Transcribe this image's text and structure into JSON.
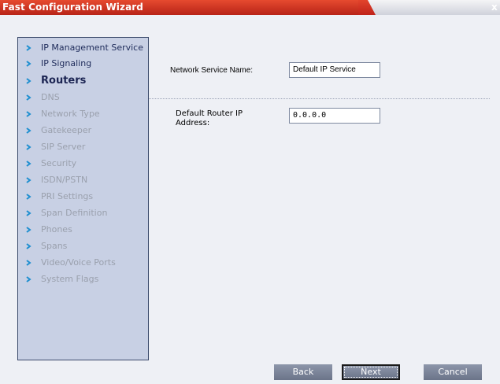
{
  "window": {
    "title": "Fast Configuration Wizard",
    "close_glyph": "x"
  },
  "sidebar": {
    "items": [
      {
        "label": "IP Management Service",
        "state": "visited"
      },
      {
        "label": "IP Signaling",
        "state": "visited"
      },
      {
        "label": "Routers",
        "state": "active"
      },
      {
        "label": "DNS",
        "state": "disabled"
      },
      {
        "label": "Network Type",
        "state": "disabled"
      },
      {
        "label": "Gatekeeper",
        "state": "disabled"
      },
      {
        "label": "SIP Server",
        "state": "disabled"
      },
      {
        "label": "Security",
        "state": "disabled"
      },
      {
        "label": "ISDN/PSTN",
        "state": "disabled"
      },
      {
        "label": "PRI Settings",
        "state": "disabled"
      },
      {
        "label": "Span Definition",
        "state": "disabled"
      },
      {
        "label": "Phones",
        "state": "disabled"
      },
      {
        "label": "Spans",
        "state": "disabled"
      },
      {
        "label": "Video/Voice Ports",
        "state": "disabled"
      },
      {
        "label": "System Flags",
        "state": "disabled"
      }
    ]
  },
  "form": {
    "network_service_name_label": "Network Service Name:",
    "network_service_name_value": "Default IP Service",
    "default_router_label_line1": "Default Router IP",
    "default_router_label_line2": "Address:",
    "default_router_value": "0.0.0.0"
  },
  "buttons": {
    "back": "Back",
    "next": "Next",
    "cancel": "Cancel"
  },
  "colors": {
    "titlebar": "#c8321f",
    "sidebar_bg": "#c8d0e4",
    "chevron": "#1f8fd0",
    "button_bg": "#7c859a"
  }
}
